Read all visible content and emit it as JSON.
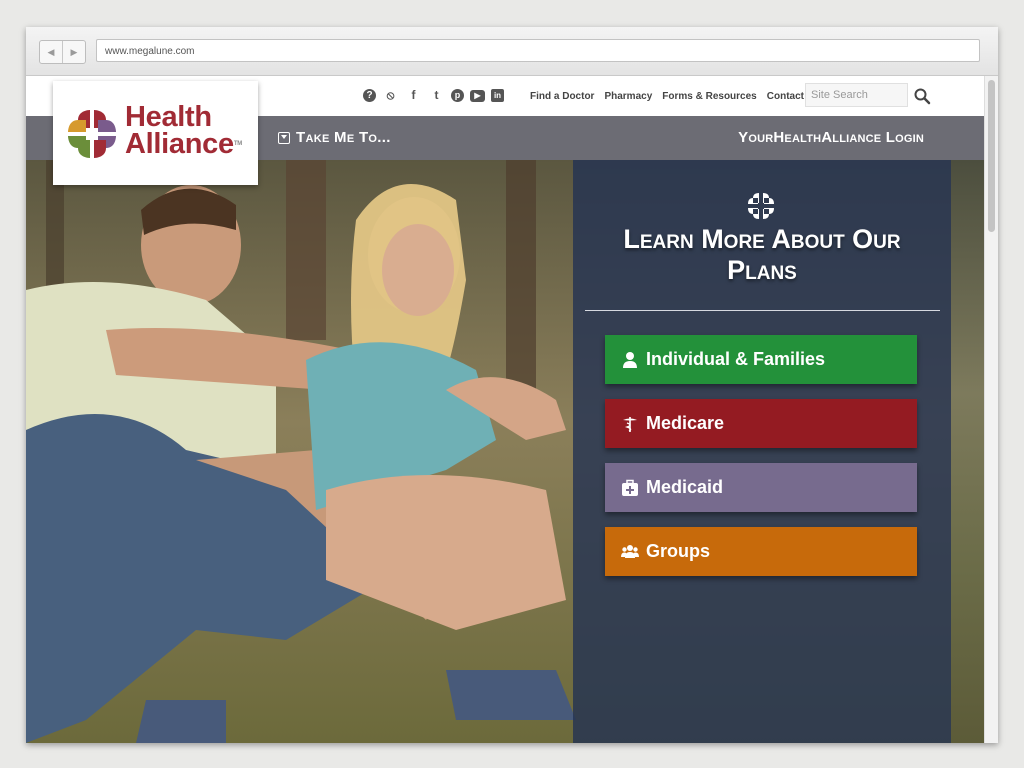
{
  "browser": {
    "url": "www.megalune.com",
    "back_label": "◀",
    "forward_label": "▶"
  },
  "header": {
    "social_icons": [
      "help-icon",
      "rss-icon",
      "facebook-icon",
      "twitter-icon",
      "pinterest-icon",
      "youtube-icon",
      "linkedin-icon"
    ],
    "social_glyphs": [
      "?",
      "⦸",
      "f",
      "t",
      "p",
      "▶",
      "in"
    ],
    "links": [
      "Find a Doctor",
      "Pharmacy",
      "Forms & Resources",
      "Contact"
    ],
    "search_placeholder": "Site Search"
  },
  "logo": {
    "line1": "Health",
    "line2": "Alliance",
    "trademark": "TM",
    "colors": {
      "red": "#a12b35",
      "green": "#6b8e3a",
      "purple": "#7a5b8c",
      "orange": "#d69a2d"
    }
  },
  "navbar": {
    "take_me_to": "Take Me To...",
    "login": "YourHealthAlliance Login",
    "color": "#6c6c74"
  },
  "panel": {
    "title_line1": "Learn More About Our",
    "title_line2": "Plans",
    "buttons": [
      {
        "label": "Individual & Families",
        "icon": "person-icon",
        "color": "#23913a"
      },
      {
        "label": "Medicare",
        "icon": "caduceus-icon",
        "color": "#941b22"
      },
      {
        "label": "Medicaid",
        "icon": "medical-kit-icon",
        "color": "#776b8e"
      },
      {
        "label": "Groups",
        "icon": "group-icon",
        "color": "#c76a0b"
      }
    ]
  }
}
